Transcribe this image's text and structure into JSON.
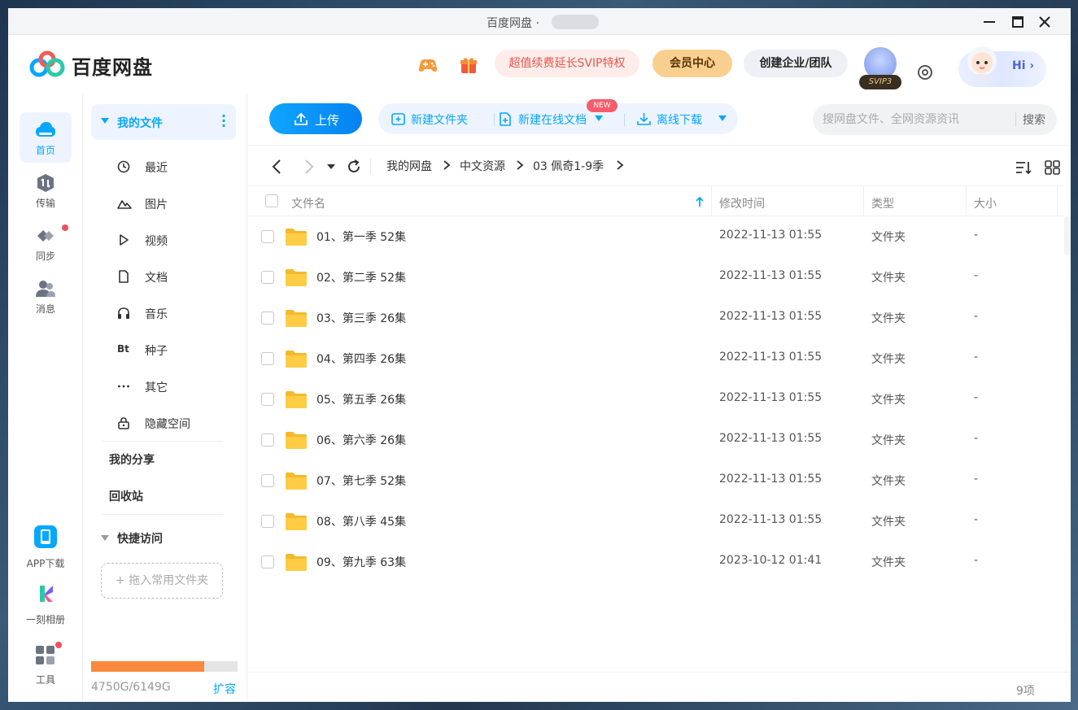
{
  "window": {
    "title": "百度网盘",
    "title_sep": "·"
  },
  "header": {
    "logo_text": "百度网盘",
    "svip_promo": "超值续费延长SVIP特权",
    "vip_center": "会员中心",
    "enterprise": "创建企业/团队",
    "svip_level": "SVIP3",
    "greeting": "Hi"
  },
  "rail": {
    "items": [
      {
        "label": "首页",
        "icon": "cloud-icon"
      },
      {
        "label": "传输",
        "icon": "transfer-icon"
      },
      {
        "label": "同步",
        "icon": "sync-icon"
      },
      {
        "label": "消息",
        "icon": "message-icon"
      }
    ],
    "bottom": [
      {
        "label": "APP下载",
        "icon": "phone-icon"
      },
      {
        "label": "一刻相册",
        "icon": "album-icon"
      },
      {
        "label": "工具",
        "icon": "tools-icon"
      }
    ]
  },
  "sidebar": {
    "my_files": "我的文件",
    "items": [
      {
        "label": "最近",
        "icon": "clock-icon"
      },
      {
        "label": "图片",
        "icon": "image-icon"
      },
      {
        "label": "视频",
        "icon": "video-icon"
      },
      {
        "label": "文档",
        "icon": "document-icon"
      },
      {
        "label": "音乐",
        "icon": "headphones-icon"
      },
      {
        "label": "种子",
        "icon": "bt-icon",
        "glyph": "Bt"
      },
      {
        "label": "其它",
        "icon": "more-icon"
      },
      {
        "label": "隐藏空间",
        "icon": "lock-icon"
      }
    ],
    "my_share": "我的分享",
    "recycle": "回收站",
    "quick_access": "快捷访问",
    "drop_hint": "+ 拖入常用文件夹",
    "quota_text": "4750G/6149G",
    "quota_used_fraction": 0.7725,
    "expand": "扩容"
  },
  "toolbar": {
    "upload": "上传",
    "new_folder": "新建文件夹",
    "new_doc": "新建在线文档",
    "new_badge": "NEW",
    "offline_download": "离线下载",
    "search_placeholder": "搜网盘文件、全网资源资讯",
    "search_button": "搜索"
  },
  "breadcrumb": [
    "我的网盘",
    "中文资源",
    "03 佩奇1-9季"
  ],
  "table": {
    "headers": {
      "name": "文件名",
      "mtime": "修改时间",
      "type": "类型",
      "size": "大小"
    },
    "rows": [
      {
        "name": "01、第一季 52集",
        "mtime": "2022-11-13 01:55",
        "type": "文件夹",
        "size": "-"
      },
      {
        "name": "02、第二季 52集",
        "mtime": "2022-11-13 01:55",
        "type": "文件夹",
        "size": "-"
      },
      {
        "name": "03、第三季 26集",
        "mtime": "2022-11-13 01:55",
        "type": "文件夹",
        "size": "-"
      },
      {
        "name": "04、第四季 26集",
        "mtime": "2022-11-13 01:55",
        "type": "文件夹",
        "size": "-"
      },
      {
        "name": "05、第五季 26集",
        "mtime": "2022-11-13 01:55",
        "type": "文件夹",
        "size": "-"
      },
      {
        "name": "06、第六季 26集",
        "mtime": "2022-11-13 01:55",
        "type": "文件夹",
        "size": "-"
      },
      {
        "name": "07、第七季 52集",
        "mtime": "2022-11-13 01:55",
        "type": "文件夹",
        "size": "-"
      },
      {
        "name": "08、第八季 45集",
        "mtime": "2022-11-13 01:55",
        "type": "文件夹",
        "size": "-"
      },
      {
        "name": "09、第九季 63集",
        "mtime": "2023-10-12 01:41",
        "type": "文件夹",
        "size": "-"
      }
    ],
    "count": "9项"
  },
  "colors": {
    "accent": "#06a7ff",
    "folder": "#ffc940",
    "quota": "#f8893f",
    "alert_dot": "#f0505a"
  }
}
